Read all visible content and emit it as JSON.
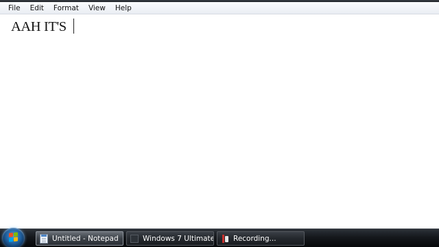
{
  "menu": {
    "file": "File",
    "edit": "Edit",
    "format": "Format",
    "view": "View",
    "help": "Help"
  },
  "editor": {
    "content": "AAH IT'S "
  },
  "taskbar": {
    "start_icon": "windows-start-orb",
    "buttons": [
      {
        "label": "Untitled - Notepad",
        "icon": "notepad-icon",
        "active": true
      },
      {
        "label": "Windows 7 Ultimate ...",
        "icon": "window-icon",
        "active": false
      },
      {
        "label": "Recording...",
        "icon": "record-icon",
        "active": false
      }
    ]
  },
  "colors": {
    "taskbar": "#15181c",
    "editor_background": "#ffffff",
    "menubar": "#f0f3f8"
  }
}
